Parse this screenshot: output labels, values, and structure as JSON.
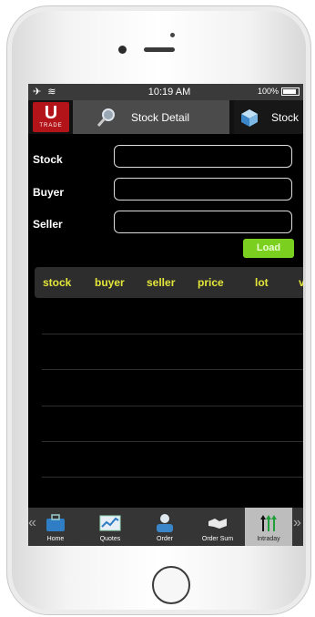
{
  "status": {
    "left_icons": "✈ ≋",
    "time": "10:19 AM",
    "battery_text": "100%"
  },
  "appbar": {
    "logo_letter": "U",
    "logo_text": "TRADE",
    "active_tab": "Stock Detail",
    "next_tab": "Stock"
  },
  "form": {
    "stock_label": "Stock",
    "buyer_label": "Buyer",
    "seller_label": "Seller",
    "stock_value": "",
    "buyer_value": "",
    "seller_value": "",
    "load_label": "Load"
  },
  "table": {
    "columns": [
      "stock",
      "buyer",
      "seller",
      "price",
      "lot",
      "v"
    ]
  },
  "nav": {
    "items": [
      "Home",
      "Quotes",
      "Order",
      "Order Sum",
      "Intraday"
    ],
    "active": "Intraday",
    "prev_arrow": "«",
    "next_arrow": "»"
  },
  "colors": {
    "accent_green": "#7bcf1f",
    "header_yellow": "#e4e63a",
    "logo_red": "#b3141a"
  }
}
